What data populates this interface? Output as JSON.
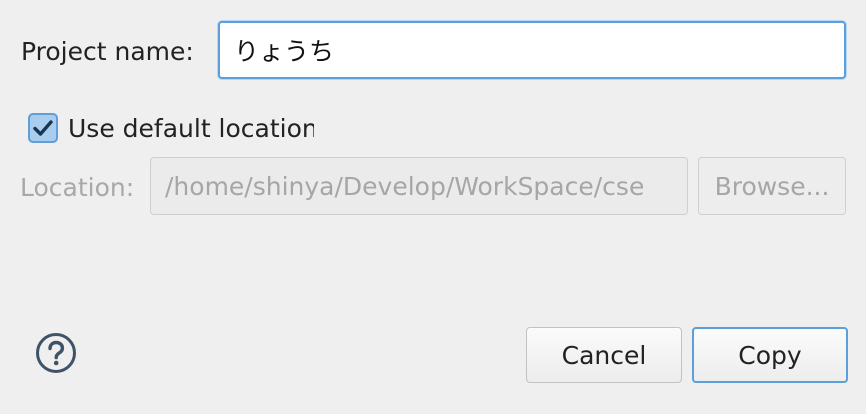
{
  "project": {
    "label": "Project name:",
    "value": "りょうち"
  },
  "location": {
    "use_default_label": "Use default location",
    "use_default_checked": true,
    "label": "Location:",
    "value": "/home/shinya/Develop/WorkSpace/cse",
    "browse_label": "Browse..."
  },
  "buttons": {
    "cancel_label": "Cancel",
    "copy_label": "Copy"
  },
  "icons": {
    "help": "help-circle-icon",
    "check": "check-icon"
  },
  "colors": {
    "accent": "#5b9fdc",
    "checkbox_fill": "#a9cdef",
    "background": "#efefef",
    "disabled_text": "#a6a6a6"
  }
}
